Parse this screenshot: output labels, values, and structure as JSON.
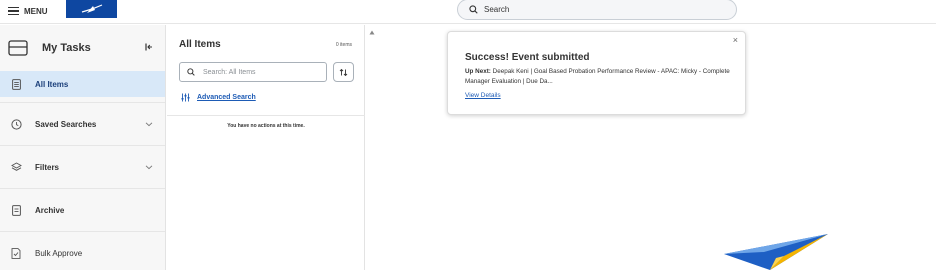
{
  "header": {
    "menu_label": "MENU",
    "search_placeholder": "Search"
  },
  "sidebar": {
    "title": "My Tasks",
    "items": [
      {
        "label": "All Items",
        "icon": "list-icon",
        "active": true
      },
      {
        "label": "Saved Searches",
        "icon": "clock-icon",
        "expandable": true
      },
      {
        "label": "Filters",
        "icon": "layers-icon",
        "expandable": true
      },
      {
        "label": "Archive",
        "icon": "archive-icon"
      },
      {
        "label": "Bulk Approve",
        "icon": "checklist-icon"
      }
    ]
  },
  "list_pane": {
    "title": "All Items",
    "count": "0 items",
    "search_placeholder": "Search: All Items",
    "advanced_search_label": "Advanced Search",
    "empty_message": "You have no actions at this time."
  },
  "toast": {
    "title": "Success! Event submitted",
    "up_next_label": "Up Next:",
    "up_next_text": "Deepak Keni | Goal Based Probation Performance Review - APAC: Micky - Complete Manager Evaluation | Due Da...",
    "view_details_label": "View Details",
    "close_glyph": "×"
  },
  "colors": {
    "accent": "#1d5bb5",
    "active_bg": "#d8e8f8",
    "logo_bg": "#0e47a1"
  }
}
